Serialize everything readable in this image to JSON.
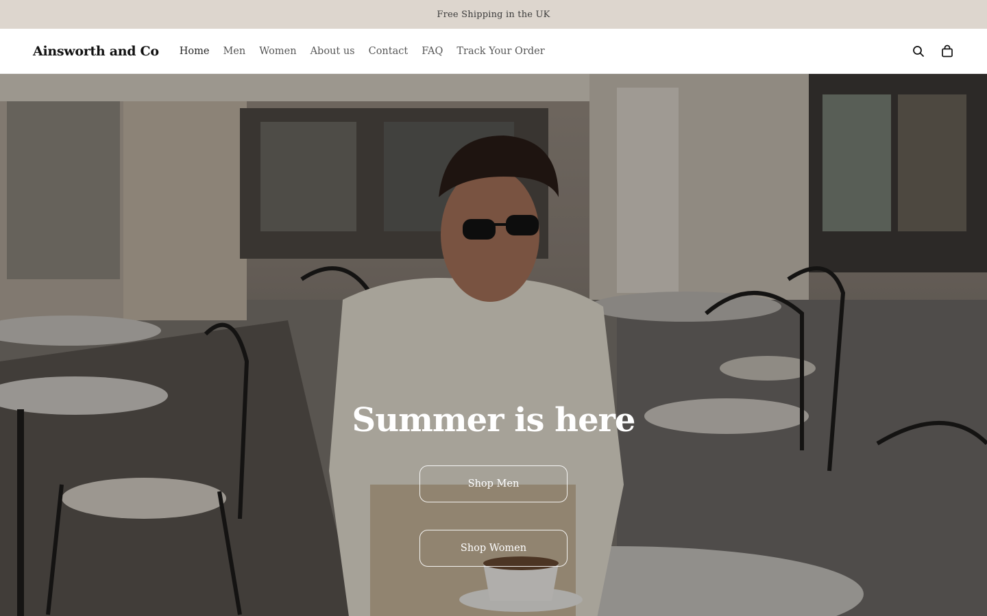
{
  "announcement": {
    "text": "Free Shipping in the UK"
  },
  "header": {
    "logo": "Ainsworth and Co",
    "nav": [
      {
        "label": "Home"
      },
      {
        "label": "Men"
      },
      {
        "label": "Women"
      },
      {
        "label": "About us"
      },
      {
        "label": "Contact"
      },
      {
        "label": "FAQ"
      },
      {
        "label": "Track Your Order"
      }
    ],
    "icons": {
      "search": "search-icon",
      "cart": "shopping-bag-icon"
    }
  },
  "hero": {
    "title": "Summer is here",
    "buttons": [
      {
        "label": "Shop Men"
      },
      {
        "label": "Shop Women"
      }
    ]
  },
  "colors": {
    "announcement_bg": "#ddd6ce",
    "header_bg": "#ffffff",
    "hero_text": "#ffffff"
  }
}
